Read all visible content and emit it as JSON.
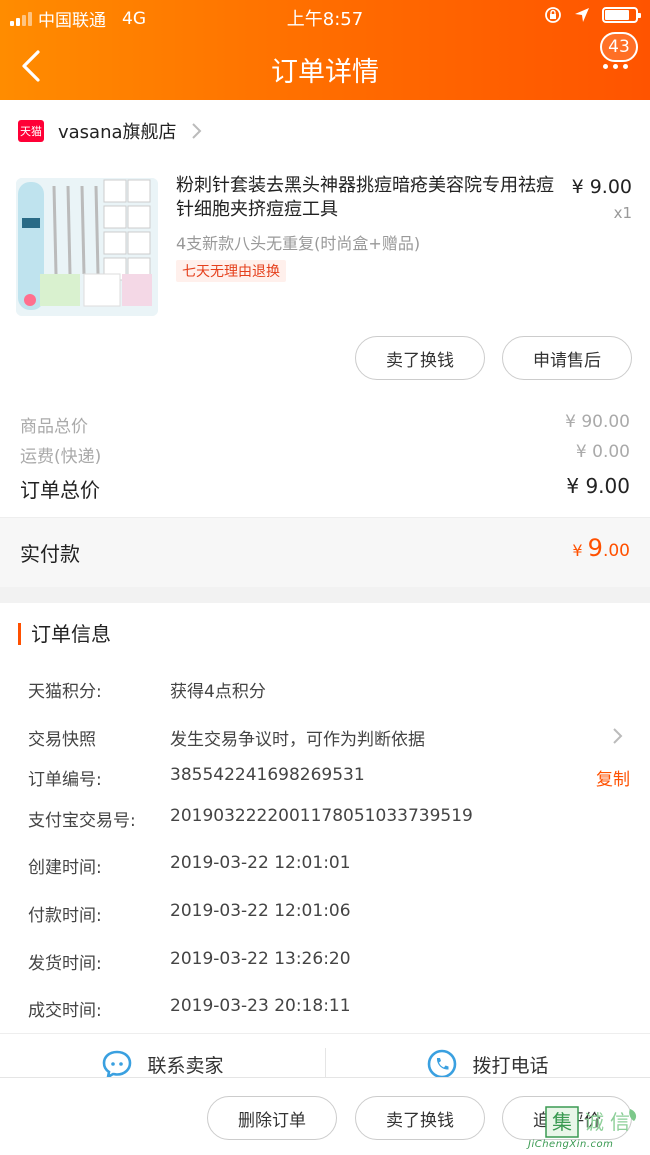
{
  "status_bar": {
    "carrier": "中国联通",
    "network": "4G",
    "time": "上午8:57"
  },
  "header": {
    "title": "订单详情",
    "badge_count": "43"
  },
  "store": {
    "badge": "天猫",
    "name": "vasana旗舰店"
  },
  "product": {
    "title": "粉刺针套装去黑头神器挑痘暗疮美容院专用祛痘针细胞夹挤痘痘工具",
    "spec": "4支新款八头无重复(时尚盒+赠品)",
    "tag": "七天无理由退换",
    "price": "¥ 9.00",
    "qty": "x1",
    "buttons": {
      "sell": "卖了换钱",
      "after_sale": "申请售后"
    }
  },
  "summary": {
    "goods_label": "商品总价",
    "goods_value": "¥ 90.00",
    "shipping_label": "运费(快递)",
    "shipping_value": "¥ 0.00",
    "total_label": "订单总价",
    "total_value": "¥ 9.00",
    "paid_label": "实付款",
    "paid_symbol": "¥",
    "paid_int": "9",
    "paid_dec": ".00"
  },
  "order_info": {
    "heading": "订单信息",
    "rows": [
      {
        "label": "天猫积分:",
        "value": "获得4点积分"
      },
      {
        "label": "交易快照",
        "value": "发生交易争议时，可作为判断依据"
      },
      {
        "label": "订单编号:",
        "value": "385542241698269531"
      },
      {
        "label": "支付宝交易号:",
        "value": "2019032222001178051033739519"
      },
      {
        "label": "创建时间:",
        "value": "2019-03-22 12:01:01"
      },
      {
        "label": "付款时间:",
        "value": "2019-03-22 12:01:06"
      },
      {
        "label": "发货时间:",
        "value": "2019-03-22 13:26:20"
      },
      {
        "label": "成交时间:",
        "value": "2019-03-23 20:18:11"
      }
    ],
    "copy_label": "复制"
  },
  "contact": {
    "seller": "联系卖家",
    "phone": "拨打电话"
  },
  "bottom": {
    "delete": "删除订单",
    "sell": "卖了换钱",
    "review": "追加评价"
  },
  "watermark": {
    "chars": "集诚",
    "text": "JiChengXin.com"
  },
  "colors": {
    "accent": "#ff5000",
    "header_start": "#ff8c00",
    "header_end": "#ff5400",
    "tmall_red": "#ff0036"
  },
  "icons": [
    "back-arrow-icon",
    "more-dots-icon",
    "tmall-icon",
    "chevron-right-icon",
    "chat-icon",
    "phone-icon",
    "location-arrow-icon",
    "rotation-lock-icon",
    "battery-icon"
  ]
}
